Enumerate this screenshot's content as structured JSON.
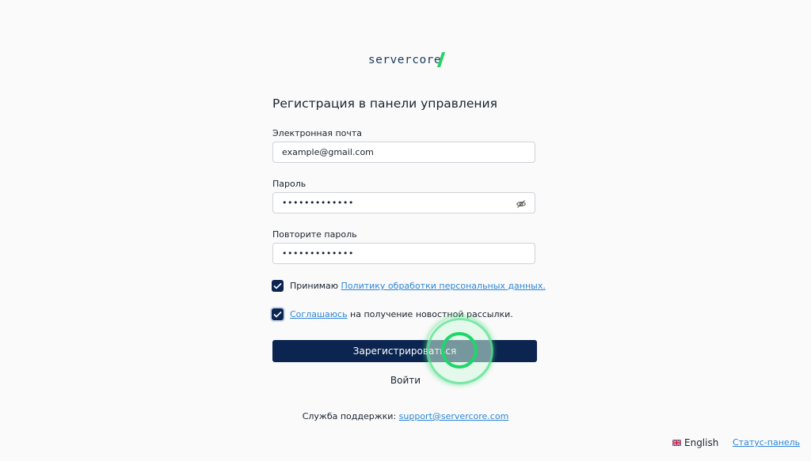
{
  "logo": {
    "text": "servercore"
  },
  "form": {
    "title": "Регистрация в панели управления",
    "email": {
      "label": "Электронная почта",
      "value": "example@gmail.com"
    },
    "password": {
      "label": "Пароль",
      "masked_value": "•••••••••••••",
      "toggle_icon": "eye-off-icon"
    },
    "password_repeat": {
      "label": "Повторите пароль",
      "masked_value": "•••••••••••••"
    },
    "consent_policy": {
      "checked": true,
      "prefix": "Принимаю ",
      "link": "Политику обработки персональных данных."
    },
    "consent_newsletter": {
      "checked": true,
      "link": "Соглашаюсь",
      "suffix": " на получение новостной рассылки."
    },
    "submit_label": "Зарегистрироваться",
    "login_label": "Войти"
  },
  "support": {
    "prefix": "Служба поддержки: ",
    "email": "support@servercore.com"
  },
  "footer": {
    "language": "English",
    "language_icon": "uk-flag-icon",
    "status_link": "Статус-панель"
  },
  "colors": {
    "primary": "#0b2450",
    "link": "#2e86d6",
    "brand_accent": "#25d366"
  }
}
